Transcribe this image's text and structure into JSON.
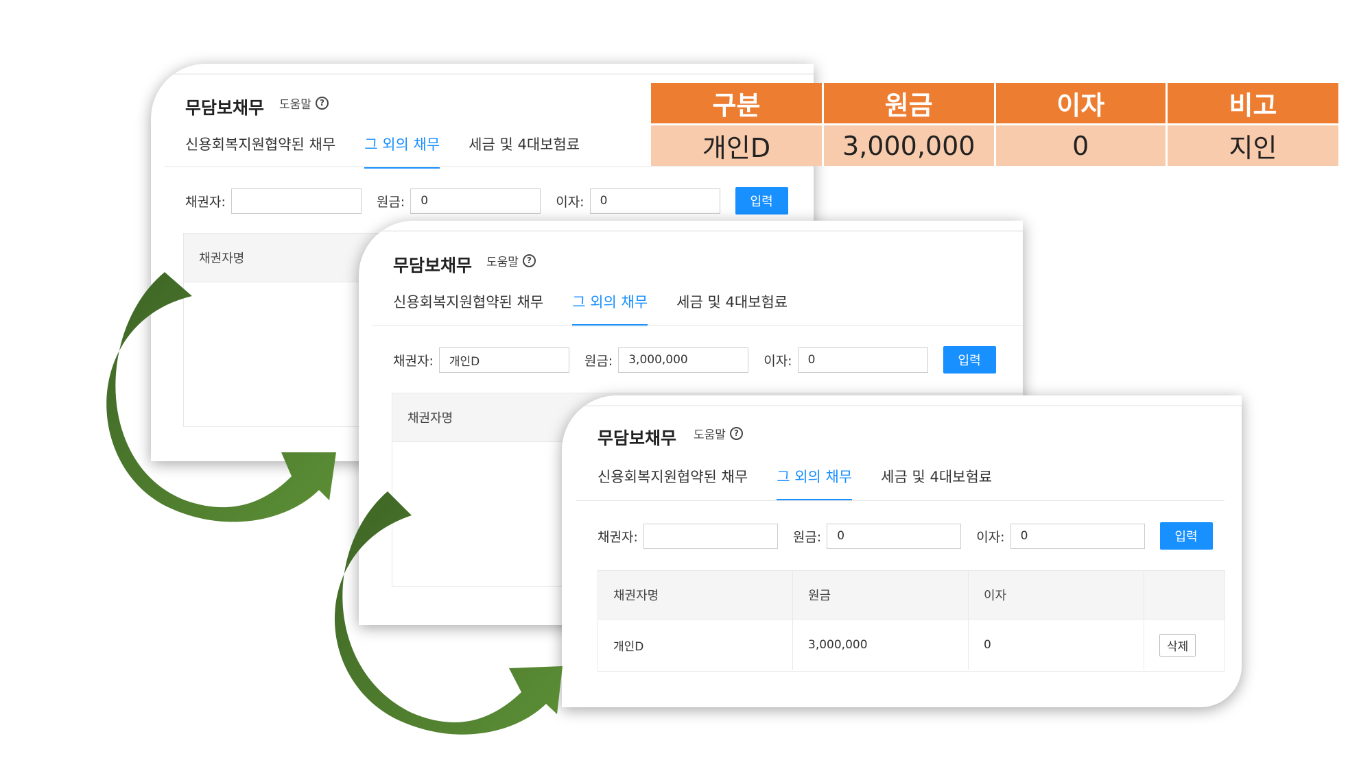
{
  "summary_table": {
    "headers": [
      "구분",
      "원금",
      "이자",
      "비고"
    ],
    "row": [
      "개인D",
      "3,000,000",
      "0",
      "지인"
    ],
    "header_color": "#ed7d31",
    "cell_color": "#f8cbad"
  },
  "panels": [
    {
      "title": "무담보채무",
      "help_label": "도움말",
      "tabs": [
        "신용회복지원협약된 채무",
        "그 외의 채무",
        "세금 및 4대보험료"
      ],
      "active_tab": 1,
      "creditor_label": "채권자:",
      "creditor_value": "",
      "principal_label": "원금:",
      "principal_value": "0",
      "interest_label": "이자:",
      "interest_value": "0",
      "submit_label": "입력",
      "list_header": "채권자명"
    },
    {
      "title": "무담보채무",
      "help_label": "도움말",
      "tabs": [
        "신용회복지원협약된 채무",
        "그 외의 채무",
        "세금 및 4대보험료"
      ],
      "active_tab": 1,
      "creditor_label": "채권자:",
      "creditor_value": "개인D",
      "principal_label": "원금:",
      "principal_value": "3,000,000",
      "interest_label": "이자:",
      "interest_value": "0",
      "submit_label": "입력",
      "list_header": "채권자명"
    },
    {
      "title": "무담보채무",
      "help_label": "도움말",
      "tabs": [
        "신용회복지원협약된 채무",
        "그 외의 채무",
        "세금 및 4대보험료"
      ],
      "active_tab": 1,
      "creditor_label": "채권자:",
      "creditor_value": "",
      "principal_label": "원금:",
      "principal_value": "0",
      "interest_label": "이자:",
      "interest_value": "0",
      "submit_label": "입력",
      "columns": [
        "채권자명",
        "원금",
        "이자"
      ],
      "rows": [
        {
          "creditor": "개인D",
          "principal": "3,000,000",
          "interest": "0",
          "action": "삭제"
        }
      ]
    }
  ],
  "accent": "#1890ff",
  "arrow_color": "#4a7a2c",
  "icons": [
    "help-circle-icon",
    "curved-arrow-icon"
  ]
}
